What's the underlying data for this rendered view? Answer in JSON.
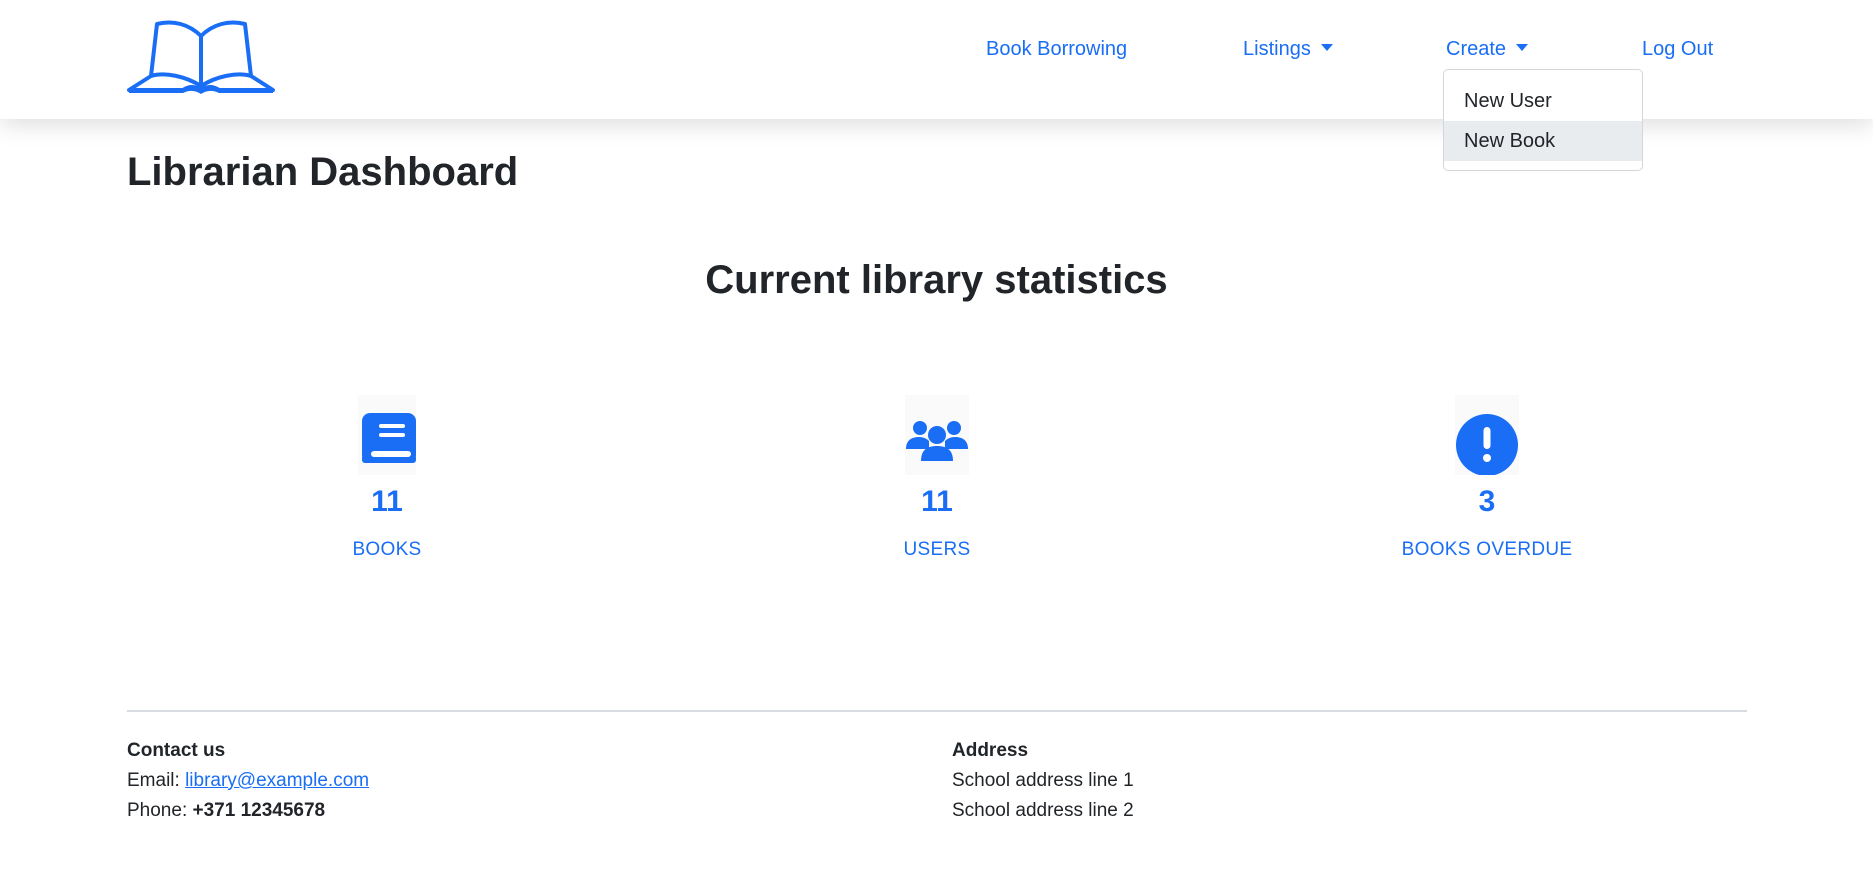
{
  "nav": {
    "logo_icon": "open-book-icon",
    "book_borrowing": "Book Borrowing",
    "listings": "Listings",
    "create": "Create",
    "log_out": "Log Out"
  },
  "create_dropdown": {
    "items": [
      "New User",
      "New Book"
    ],
    "highlighted": "New Book"
  },
  "page": {
    "title": "Librarian Dashboard",
    "section_title": "Current library statistics"
  },
  "stats": [
    {
      "icon": "book-icon",
      "value": "11",
      "label": "BOOKS"
    },
    {
      "icon": "users-icon",
      "value": "11",
      "label": "USERS"
    },
    {
      "icon": "exclamation-circle-icon",
      "value": "3",
      "label": "BOOKS OVERDUE"
    }
  ],
  "footer": {
    "contact_heading": "Contact us",
    "email_label": "Email:",
    "email": "library@example.com",
    "phone_label": "Phone:",
    "phone": "+371 12345678",
    "address_heading": "Address",
    "address_line1": "School address line 1",
    "address_line2": "School address line 2"
  },
  "colors": {
    "accent": "#1a6ef5",
    "text": "#212529"
  }
}
